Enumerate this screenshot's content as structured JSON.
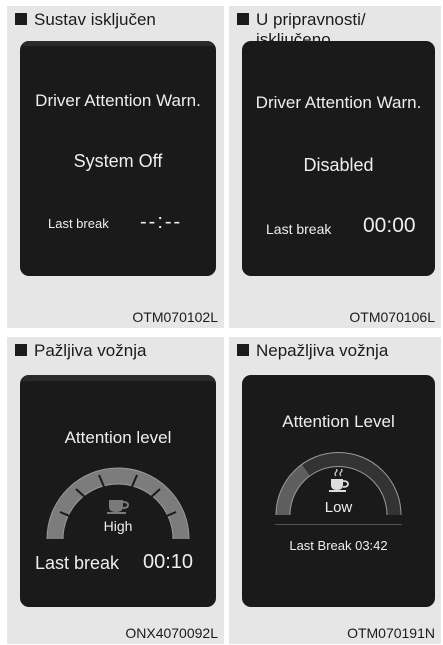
{
  "panels": [
    {
      "title": "Sustav isključen",
      "heading": "Driver Attention Warn.",
      "status": "System Off",
      "break_label": "Last break",
      "break_value": "--:--",
      "code": "OTM070102L"
    },
    {
      "title_line1": "U pripravnosti/",
      "title_line2": "isključeno",
      "heading": "Driver Attention Warn.",
      "status": "Disabled",
      "break_label": "Last break",
      "break_value": "00:00",
      "code": "OTM070106L"
    },
    {
      "title": "Pažljiva vožnja",
      "heading": "Attention level",
      "level": "High",
      "level_fraction": 1.0,
      "break_label": "Last break",
      "break_value": "00:10",
      "code": "ONX4070092L"
    },
    {
      "title": "Nepažljiva vožnja",
      "heading": "Attention Level",
      "level": "Low",
      "level_fraction": 0.3,
      "break_text": "Last Break 03:42",
      "code": "OTM070191N"
    }
  ],
  "icons": {
    "cup": "coffee-cup-icon",
    "steam": "steam-icon",
    "bullet": "square-bullet-icon"
  },
  "colors": {
    "panel_bg": "#e6e6e6",
    "screen_bg": "#1a1a1a",
    "text": "#eeeeee",
    "gauge_high": "#7a7a7a",
    "gauge_low": "#5a5a5a"
  }
}
